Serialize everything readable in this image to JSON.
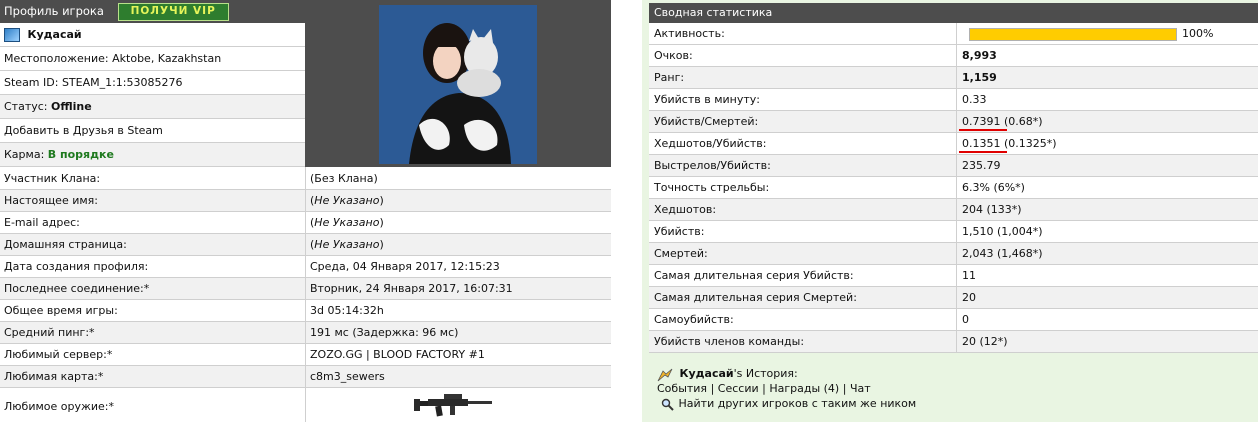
{
  "profile": {
    "header": "Профиль игрока",
    "vip_button": "ПОЛУЧИ VIP",
    "player_name": "Кудасай",
    "location_label": "Местоположение:",
    "location_value": "Aktobe, Kazakhstan",
    "steam_label": "Steam ID:",
    "steam_value": "STEAM_1:1:53085276",
    "status_label": "Статус:",
    "status_value": "Offline",
    "add_friend": "Добавить в Друзья в Steam",
    "karma_label": "Карма:",
    "karma_value": "В порядке",
    "rows": [
      {
        "key": "Участник Клана:",
        "value": "(Без Клана)"
      },
      {
        "key": "Настоящее имя:",
        "value": "(Не Указано)"
      },
      {
        "key": "E-mail адрес:",
        "value": "(Не Указано)"
      },
      {
        "key": "Домашняя страница:",
        "value": "(Не Указано)"
      },
      {
        "key": "Дата создания профиля:",
        "value": "Среда, 04 Января 2017, 12:15:23"
      },
      {
        "key": "Последнее соединение:*",
        "value": "Вторник, 24 Января 2017, 16:07:31"
      },
      {
        "key": "Общее время игры:",
        "value": "3d 05:14:32h"
      },
      {
        "key": "Средний пинг:*",
        "value": "191 мс (Задержка: 96 мс)"
      },
      {
        "key": "Любимый сервер:*",
        "value": "ZOZO.GG | BLOOD FACTORY #1"
      },
      {
        "key": "Любимая карта:*",
        "value": "c8m3_sewers"
      },
      {
        "key": "Любимое оружие:*",
        "value": ""
      }
    ]
  },
  "stats": {
    "header": "Сводная статистика",
    "activity_label": "Активность:",
    "activity_percent": 100,
    "activity_text": "100%",
    "rows": [
      {
        "key": "Очков:",
        "value": "8,993",
        "bold": true
      },
      {
        "key": "Ранг:",
        "value": "1,159",
        "bold": true
      },
      {
        "key": "Убийств в минуту:",
        "value": "0.33"
      },
      {
        "key": "Убийств/Смертей:",
        "value": "0.7391 (0.68*)"
      },
      {
        "key": "Хедшотов/Убийств:",
        "value": "0.1351 (0.1325*)"
      },
      {
        "key": "Выстрелов/Убийств:",
        "value": "235.79"
      },
      {
        "key": "Точность стрельбы:",
        "value": "6.3% (6%*)"
      },
      {
        "key": "Хедшотов:",
        "value": "204 (133*)"
      },
      {
        "key": "Убийств:",
        "value": "1,510 (1,004*)"
      },
      {
        "key": "Смертей:",
        "value": "2,043 (1,468*)"
      },
      {
        "key": "Самая длительная серия Убийств:",
        "value": "11"
      },
      {
        "key": "Самая длительная серия Смертей:",
        "value": "20"
      },
      {
        "key": "Самоубийств:",
        "value": "0"
      },
      {
        "key": "Убийств членов команды:",
        "value": "20 (12*)"
      }
    ]
  },
  "history": {
    "name": "Кудасай",
    "suffix": "'s История:",
    "links": [
      "События",
      "Сессии",
      "Награды (4)",
      "Чат"
    ],
    "separator": "|",
    "search_text": "Найти других игроков с таким же ником"
  },
  "colors": {
    "header_bg": "#4d4d4d",
    "vip_bg": "#2e7d2e",
    "vip_text": "#e6f55a",
    "karma": "#1f7a1f",
    "bar": "#ffcc00",
    "right_bg": "#e9f5e2",
    "underline": "#e00000"
  },
  "icons": {
    "player": "steam-player-icon",
    "history": "history-icon",
    "search": "magnifier-icon",
    "weapon": "rifle-icon"
  }
}
